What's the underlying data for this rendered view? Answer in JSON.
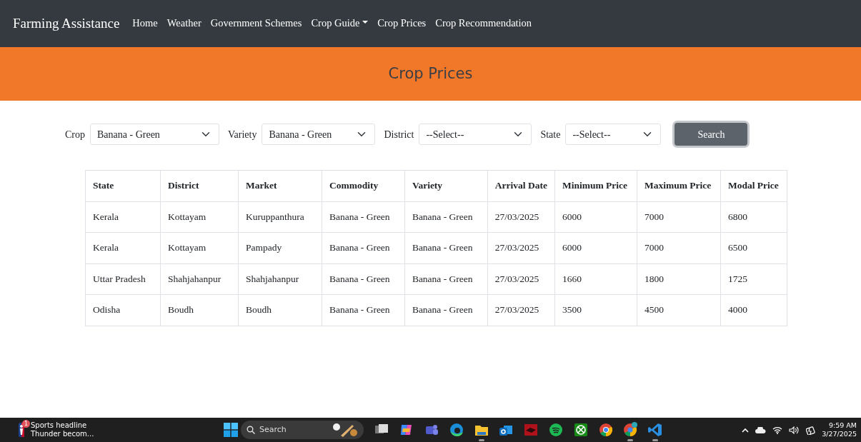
{
  "navbar": {
    "brand": "Farming Assistance",
    "links": [
      {
        "label": "Home",
        "dropdown": false
      },
      {
        "label": "Weather",
        "dropdown": false
      },
      {
        "label": "Government Schemes",
        "dropdown": false
      },
      {
        "label": "Crop Guide",
        "dropdown": true
      },
      {
        "label": "Crop Prices",
        "dropdown": false
      },
      {
        "label": "Crop Recommendation",
        "dropdown": false
      }
    ]
  },
  "banner": {
    "title": "Crop Prices"
  },
  "filters": [
    {
      "label": "Crop",
      "value": "Banana - Green"
    },
    {
      "label": "Variety",
      "value": "Banana - Green"
    },
    {
      "label": "District",
      "value": "--Select--"
    },
    {
      "label": "State",
      "value": "--Select--"
    }
  ],
  "search_button": "Search",
  "table": {
    "columns": [
      "State",
      "District",
      "Market",
      "Commodity",
      "Variety",
      "Arrival Date",
      "Minimum Price",
      "Maximum Price",
      "Modal Price"
    ],
    "rows": [
      [
        "Kerala",
        "Kottayam",
        "Kuruppanthura",
        "Banana - Green",
        "Banana - Green",
        "27/03/2025",
        "6000",
        "7000",
        "6800"
      ],
      [
        "Kerala",
        "Kottayam",
        "Pampady",
        "Banana - Green",
        "Banana - Green",
        "27/03/2025",
        "6000",
        "7000",
        "6500"
      ],
      [
        "Uttar Pradesh",
        "Shahjahanpur",
        "Shahjahanpur",
        "Banana - Green",
        "Banana - Green",
        "27/03/2025",
        "1660",
        "1800",
        "1725"
      ],
      [
        "Odisha",
        "Boudh",
        "Boudh",
        "Banana - Green",
        "Banana - Green",
        "27/03/2025",
        "3500",
        "4500",
        "4000"
      ]
    ]
  },
  "taskbar": {
    "widget": {
      "badge": "1",
      "title": "Sports headline",
      "subtitle": "Thunder becom..."
    },
    "search": {
      "placeholder": "Search"
    },
    "apps": [
      {
        "kind": "taskview",
        "running": false
      },
      {
        "kind": "copilot",
        "running": false
      },
      {
        "kind": "teams",
        "running": false
      },
      {
        "kind": "edge",
        "running": false
      },
      {
        "kind": "folder",
        "running": true
      },
      {
        "kind": "mail",
        "running": false
      },
      {
        "kind": "red",
        "running": false
      },
      {
        "kind": "spotify",
        "running": false
      },
      {
        "kind": "xbox",
        "running": false
      },
      {
        "kind": "chrome",
        "running": false
      },
      {
        "kind": "chrome2",
        "running": true
      },
      {
        "kind": "vscode",
        "running": true
      }
    ],
    "time": "9:59 AM",
    "date": "3/27/2025"
  }
}
